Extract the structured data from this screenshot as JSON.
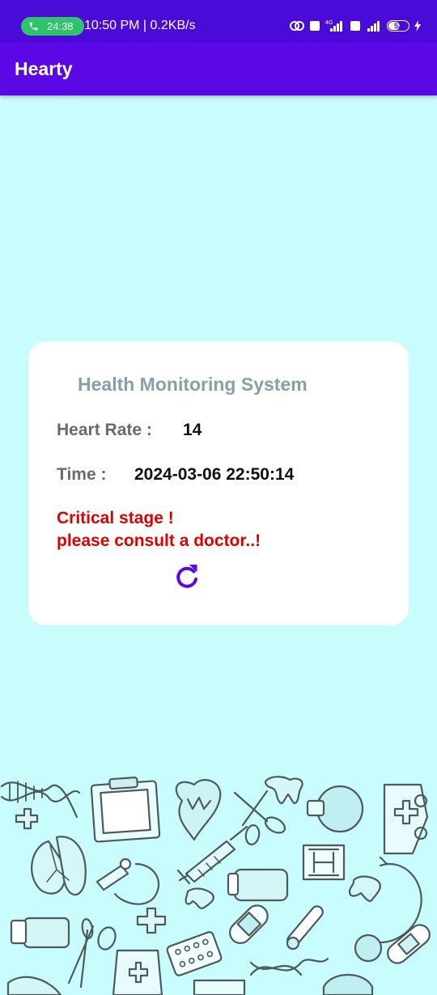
{
  "status_bar": {
    "call_timer": "24:38",
    "time_speed": "10:50 PM | 0.2KB/s",
    "network_label": "4G",
    "battery": "52",
    "battery_level": 0.52
  },
  "app_bar": {
    "title": "Hearty"
  },
  "card": {
    "title": "Health Monitoring System",
    "heart_rate_label": "Heart Rate :",
    "heart_rate_value": "14",
    "time_label": "Time :",
    "time_value": "2024-03-06 22:50:14",
    "alert_line1": "Critical stage !",
    "alert_line2": "please consult a doctor..!",
    "refresh_icon": "refresh-icon"
  },
  "colors": {
    "status_bar": "#4a0ad8",
    "app_bar": "#5b07e6",
    "background": "#c9fcfd",
    "card": "#ffffff",
    "card_title": "#87a0a8",
    "label": "#6a6a6a",
    "alert": "#e00000",
    "accent": "#5b07e6"
  },
  "background_illustration": {
    "icons": [
      "dna-icon",
      "clipboard-icon",
      "heart-organ-icon",
      "scissors-icon",
      "tooth-icon",
      "flask-icon",
      "medical-kit-icon",
      "cross-icon",
      "lungs-icon",
      "microscope-icon",
      "syringe-icon",
      "pill-bottle-icon",
      "hospital-sign-icon",
      "stethoscope-icon",
      "bandage-icon",
      "thermometer-icon",
      "pill-blister-icon"
    ]
  }
}
